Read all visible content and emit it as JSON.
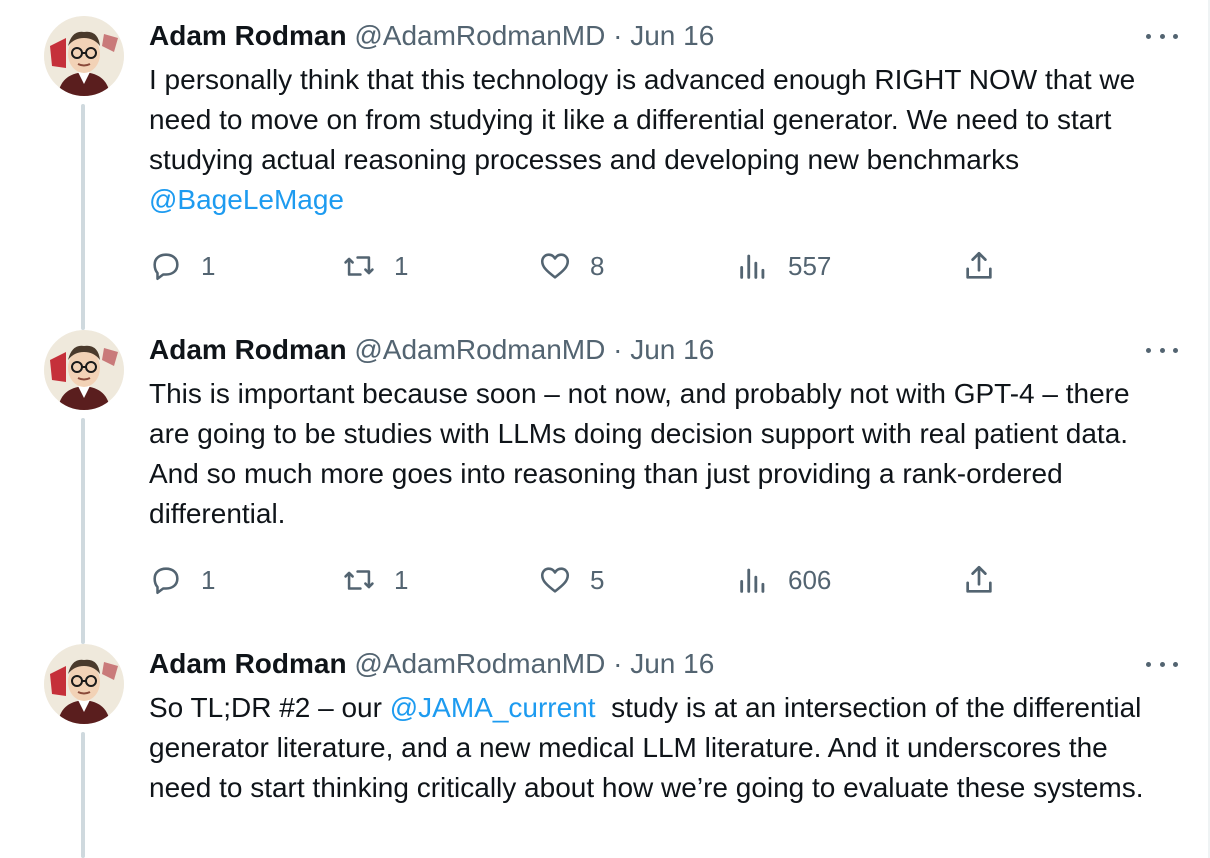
{
  "tweets": [
    {
      "author": {
        "name": "Adam Rodman",
        "handle": "@AdamRodmanMD",
        "sep": "·",
        "date": "Jun 16"
      },
      "text_plain": "I personally think that this technology is advanced enough RIGHT NOW that we need to move on from studying it like a differential generator. We need to start studying actual reasoning processes and developing new benchmarks ",
      "mention": "@BageLeMage",
      "text_after": "",
      "stats": {
        "replies": "1",
        "retweets": "1",
        "likes": "8",
        "views": "557"
      }
    },
    {
      "author": {
        "name": "Adam Rodman",
        "handle": "@AdamRodmanMD",
        "sep": "·",
        "date": "Jun 16"
      },
      "text_plain": "This is  important because soon – not now, and probably not with GPT-4 – there are going to be studies with LLMs doing decision support with real patient data. And so much more goes into reasoning than just providing a rank-ordered differential.",
      "stats": {
        "replies": "1",
        "retweets": "1",
        "likes": "5",
        "views": "606"
      }
    },
    {
      "author": {
        "name": "Adam Rodman",
        "handle": "@AdamRodmanMD",
        "sep": "·",
        "date": "Jun 16"
      },
      "text_before": "So TL;DR #2 – our ",
      "mention": "@JAMA_current",
      "text_after": "  study is at an intersection of the differential generator literature, and a new medical LLM literature. And it underscores the need to start thinking critically about how we’re going to evaluate these systems."
    }
  ],
  "icons": {
    "reply": "reply-icon",
    "retweet": "retweet-icon",
    "like": "heart-icon",
    "views": "views-icon",
    "share": "share-icon",
    "more": "more-icon"
  },
  "colors": {
    "text": "#0f1419",
    "secondary": "#536471",
    "link": "#1d9bf0",
    "thread_line": "#cfd9de"
  }
}
